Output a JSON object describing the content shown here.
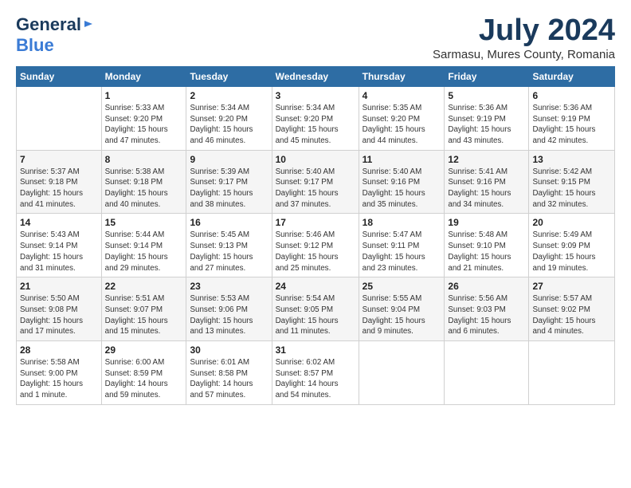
{
  "header": {
    "logo_general": "General",
    "logo_blue": "Blue",
    "month_title": "July 2024",
    "subtitle": "Sarmasu, Mures County, Romania"
  },
  "days_of_week": [
    "Sunday",
    "Monday",
    "Tuesday",
    "Wednesday",
    "Thursday",
    "Friday",
    "Saturday"
  ],
  "weeks": [
    [
      {
        "day": "",
        "info": ""
      },
      {
        "day": "1",
        "info": "Sunrise: 5:33 AM\nSunset: 9:20 PM\nDaylight: 15 hours\nand 47 minutes."
      },
      {
        "day": "2",
        "info": "Sunrise: 5:34 AM\nSunset: 9:20 PM\nDaylight: 15 hours\nand 46 minutes."
      },
      {
        "day": "3",
        "info": "Sunrise: 5:34 AM\nSunset: 9:20 PM\nDaylight: 15 hours\nand 45 minutes."
      },
      {
        "day": "4",
        "info": "Sunrise: 5:35 AM\nSunset: 9:20 PM\nDaylight: 15 hours\nand 44 minutes."
      },
      {
        "day": "5",
        "info": "Sunrise: 5:36 AM\nSunset: 9:19 PM\nDaylight: 15 hours\nand 43 minutes."
      },
      {
        "day": "6",
        "info": "Sunrise: 5:36 AM\nSunset: 9:19 PM\nDaylight: 15 hours\nand 42 minutes."
      }
    ],
    [
      {
        "day": "7",
        "info": "Sunrise: 5:37 AM\nSunset: 9:18 PM\nDaylight: 15 hours\nand 41 minutes."
      },
      {
        "day": "8",
        "info": "Sunrise: 5:38 AM\nSunset: 9:18 PM\nDaylight: 15 hours\nand 40 minutes."
      },
      {
        "day": "9",
        "info": "Sunrise: 5:39 AM\nSunset: 9:17 PM\nDaylight: 15 hours\nand 38 minutes."
      },
      {
        "day": "10",
        "info": "Sunrise: 5:40 AM\nSunset: 9:17 PM\nDaylight: 15 hours\nand 37 minutes."
      },
      {
        "day": "11",
        "info": "Sunrise: 5:40 AM\nSunset: 9:16 PM\nDaylight: 15 hours\nand 35 minutes."
      },
      {
        "day": "12",
        "info": "Sunrise: 5:41 AM\nSunset: 9:16 PM\nDaylight: 15 hours\nand 34 minutes."
      },
      {
        "day": "13",
        "info": "Sunrise: 5:42 AM\nSunset: 9:15 PM\nDaylight: 15 hours\nand 32 minutes."
      }
    ],
    [
      {
        "day": "14",
        "info": "Sunrise: 5:43 AM\nSunset: 9:14 PM\nDaylight: 15 hours\nand 31 minutes."
      },
      {
        "day": "15",
        "info": "Sunrise: 5:44 AM\nSunset: 9:14 PM\nDaylight: 15 hours\nand 29 minutes."
      },
      {
        "day": "16",
        "info": "Sunrise: 5:45 AM\nSunset: 9:13 PM\nDaylight: 15 hours\nand 27 minutes."
      },
      {
        "day": "17",
        "info": "Sunrise: 5:46 AM\nSunset: 9:12 PM\nDaylight: 15 hours\nand 25 minutes."
      },
      {
        "day": "18",
        "info": "Sunrise: 5:47 AM\nSunset: 9:11 PM\nDaylight: 15 hours\nand 23 minutes."
      },
      {
        "day": "19",
        "info": "Sunrise: 5:48 AM\nSunset: 9:10 PM\nDaylight: 15 hours\nand 21 minutes."
      },
      {
        "day": "20",
        "info": "Sunrise: 5:49 AM\nSunset: 9:09 PM\nDaylight: 15 hours\nand 19 minutes."
      }
    ],
    [
      {
        "day": "21",
        "info": "Sunrise: 5:50 AM\nSunset: 9:08 PM\nDaylight: 15 hours\nand 17 minutes."
      },
      {
        "day": "22",
        "info": "Sunrise: 5:51 AM\nSunset: 9:07 PM\nDaylight: 15 hours\nand 15 minutes."
      },
      {
        "day": "23",
        "info": "Sunrise: 5:53 AM\nSunset: 9:06 PM\nDaylight: 15 hours\nand 13 minutes."
      },
      {
        "day": "24",
        "info": "Sunrise: 5:54 AM\nSunset: 9:05 PM\nDaylight: 15 hours\nand 11 minutes."
      },
      {
        "day": "25",
        "info": "Sunrise: 5:55 AM\nSunset: 9:04 PM\nDaylight: 15 hours\nand 9 minutes."
      },
      {
        "day": "26",
        "info": "Sunrise: 5:56 AM\nSunset: 9:03 PM\nDaylight: 15 hours\nand 6 minutes."
      },
      {
        "day": "27",
        "info": "Sunrise: 5:57 AM\nSunset: 9:02 PM\nDaylight: 15 hours\nand 4 minutes."
      }
    ],
    [
      {
        "day": "28",
        "info": "Sunrise: 5:58 AM\nSunset: 9:00 PM\nDaylight: 15 hours\nand 1 minute."
      },
      {
        "day": "29",
        "info": "Sunrise: 6:00 AM\nSunset: 8:59 PM\nDaylight: 14 hours\nand 59 minutes."
      },
      {
        "day": "30",
        "info": "Sunrise: 6:01 AM\nSunset: 8:58 PM\nDaylight: 14 hours\nand 57 minutes."
      },
      {
        "day": "31",
        "info": "Sunrise: 6:02 AM\nSunset: 8:57 PM\nDaylight: 14 hours\nand 54 minutes."
      },
      {
        "day": "",
        "info": ""
      },
      {
        "day": "",
        "info": ""
      },
      {
        "day": "",
        "info": ""
      }
    ]
  ]
}
